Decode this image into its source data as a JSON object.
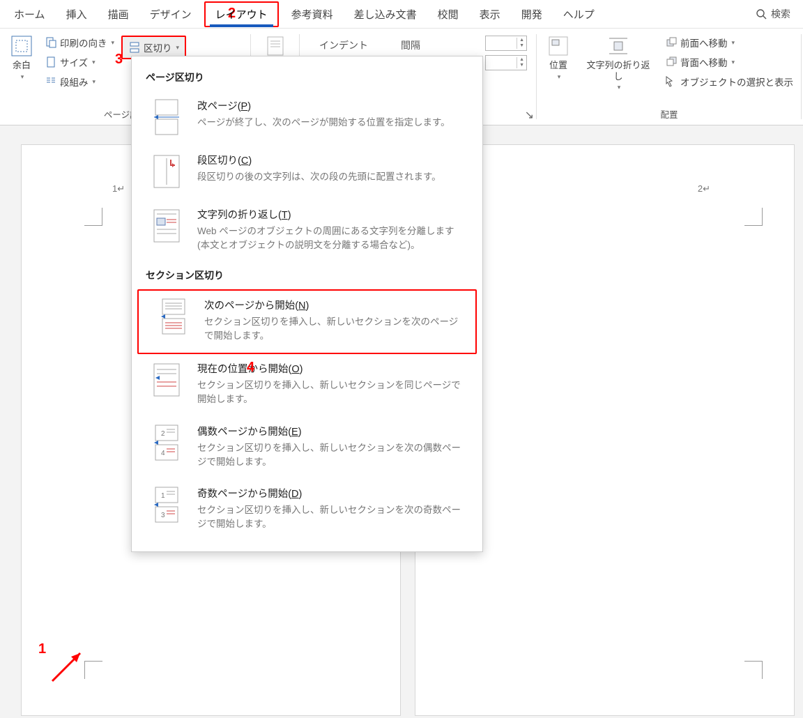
{
  "tabs": {
    "home": "ホーム",
    "insert": "挿入",
    "draw": "描画",
    "design": "デザイン",
    "layout": "レイアウト",
    "references": "参考資料",
    "mailings": "差し込み文書",
    "review": "校閲",
    "view": "表示",
    "developer": "開発",
    "help": "ヘルプ"
  },
  "search_label": "検索",
  "page_setup": {
    "margins": "余白",
    "orientation": "印刷の向き",
    "size": "サイズ",
    "columns": "段組み",
    "breaks": "区切り",
    "group_label": "ページ設定"
  },
  "paragraph": {
    "indent_label": "インデント",
    "spacing_label": "間隔"
  },
  "arrange": {
    "position": "位置",
    "wrap": "文字列の折り返し",
    "bring_forward": "前面へ移動",
    "send_backward": "背面へ移動",
    "selection_pane": "オブジェクトの選択と表示",
    "group_label": "配置"
  },
  "dropdown": {
    "section1_title": "ページ区切り",
    "items1": [
      {
        "title_pre": "改ページ(",
        "hot": "P",
        "title_post": ")",
        "desc": "ページが終了し、次のページが開始する位置を指定します。"
      },
      {
        "title_pre": "段区切り(",
        "hot": "C",
        "title_post": ")",
        "desc": "段区切りの後の文字列は、次の段の先頭に配置されます。"
      },
      {
        "title_pre": "文字列の折り返し(",
        "hot": "T",
        "title_post": ")",
        "desc": "Web ページのオブジェクトの周囲にある文字列を分離します (本文とオブジェクトの説明文を分離する場合など)。"
      }
    ],
    "section2_title": "セクション区切り",
    "items2": [
      {
        "title_pre": "次のページから開始(",
        "hot": "N",
        "title_post": ")",
        "desc": "セクション区切りを挿入し、新しいセクションを次のページで開始します。"
      },
      {
        "title_pre": "現在の位置から開始(",
        "hot": "O",
        "title_post": ")",
        "desc": "セクション区切りを挿入し、新しいセクションを同じページで開始します。"
      },
      {
        "title_pre": "偶数ページから開始(",
        "hot": "E",
        "title_post": ")",
        "desc": "セクション区切りを挿入し、新しいセクションを次の偶数ページで開始します。"
      },
      {
        "title_pre": "奇数ページから開始(",
        "hot": "D",
        "title_post": ")",
        "desc": "セクション区切りを挿入し、新しいセクションを次の奇数ページで開始します。"
      }
    ]
  },
  "callouts": {
    "n1": "1",
    "n2": "2",
    "n3": "3",
    "n4": "4"
  },
  "ruler": {
    "left_page": "1",
    "right_page": "2"
  }
}
